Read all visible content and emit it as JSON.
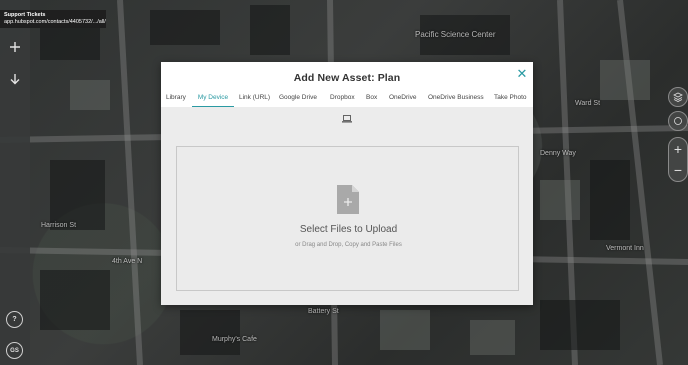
{
  "tooltip": {
    "title": "Support Tickets",
    "url": "app.hubspot.com/contacts/4405732/.../all/"
  },
  "map_labels": [
    "Pacific Science Center",
    "Ward St",
    "Vermont Inn",
    "Harrison St",
    "Murphy's Cafe",
    "4th Ave N",
    "Battery St",
    "Denny Way"
  ],
  "left_bar": {
    "add_icon": "plus-icon",
    "download_icon": "arrow-down-icon",
    "help_label": "?",
    "gs_label": "GS"
  },
  "modal": {
    "title": "Add New Asset: Plan",
    "close_label": "✕",
    "tabs": [
      "Library",
      "My Device",
      "Link (URL)",
      "Google Drive",
      "Dropbox",
      "Box",
      "OneDrive",
      "OneDrive Business",
      "Take Photo"
    ],
    "active_tab": "My Device",
    "device_icon": "laptop-icon",
    "drop_title": "Select Files to Upload",
    "drop_subtitle": "or Drag and Drop, Copy and Paste Files"
  },
  "colors": {
    "accent": "#2a9aa3",
    "modal_bg": "#ececec",
    "toolbar": "#373a39"
  }
}
